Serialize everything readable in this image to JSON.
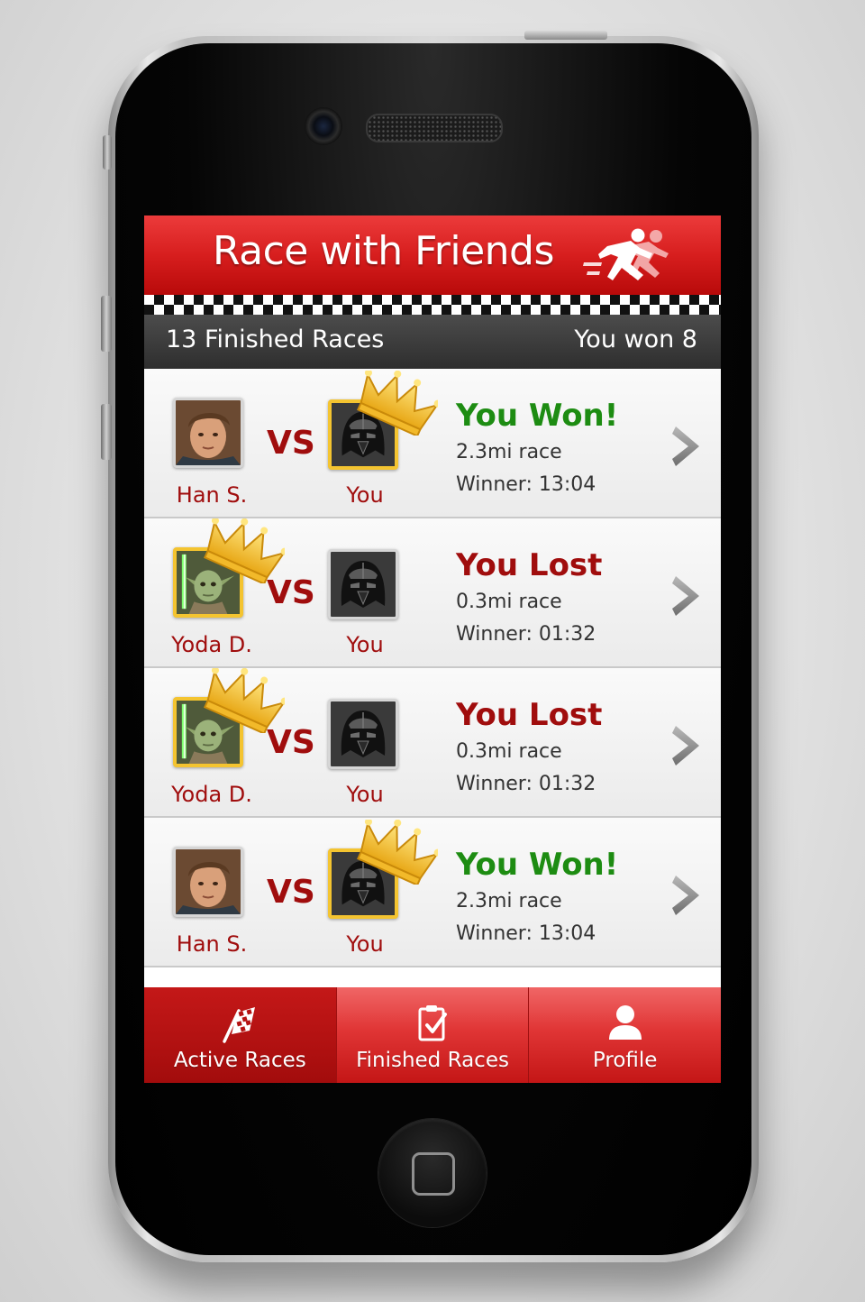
{
  "app": {
    "title": "Race with Friends"
  },
  "summary": {
    "finished_races": "13 Finished Races",
    "you_won": "You won 8"
  },
  "races": [
    {
      "opponent_name": "Han S.",
      "opponent_avatar": "han-avatar",
      "opponent_won": false,
      "vs": "VS",
      "you_name": "You",
      "you_won": true,
      "result": "You Won!",
      "distance": "2.3mi race",
      "winner_time": "Winner: 13:04"
    },
    {
      "opponent_name": "Yoda D.",
      "opponent_avatar": "yoda-avatar",
      "opponent_won": true,
      "vs": "VS",
      "you_name": "You",
      "you_won": false,
      "result": "You Lost",
      "distance": "0.3mi race",
      "winner_time": "Winner: 01:32"
    },
    {
      "opponent_name": "Yoda D.",
      "opponent_avatar": "yoda-avatar",
      "opponent_won": true,
      "vs": "VS",
      "you_name": "You",
      "you_won": false,
      "result": "You Lost",
      "distance": "0.3mi race",
      "winner_time": "Winner: 01:32"
    },
    {
      "opponent_name": "Han S.",
      "opponent_avatar": "han-avatar",
      "opponent_won": false,
      "vs": "VS",
      "you_name": "You",
      "you_won": true,
      "result": "You Won!",
      "distance": "2.3mi race",
      "winner_time": "Winner: 13:04"
    }
  ],
  "tabs": [
    {
      "label": "Active Races",
      "icon": "checkered-flag-icon",
      "active": true
    },
    {
      "label": "Finished Races",
      "icon": "clipboard-check-icon",
      "active": false
    },
    {
      "label": "Profile",
      "icon": "person-icon",
      "active": false
    }
  ],
  "colors": {
    "brand_red": "#d71e1e",
    "won_green": "#1d8c12",
    "lost_red": "#a00d0d",
    "crown_gold": "#f4c430"
  }
}
